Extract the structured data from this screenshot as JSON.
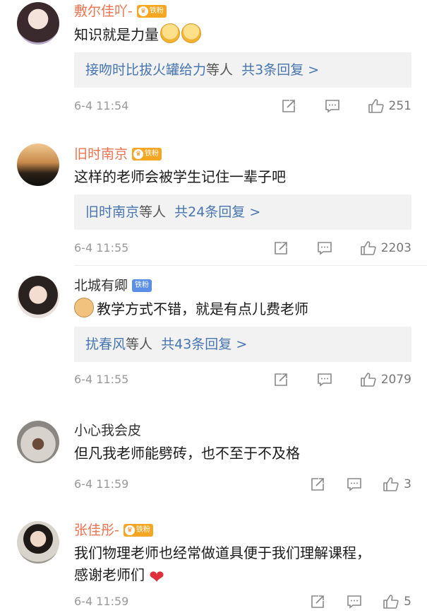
{
  "comments": [
    {
      "username": "敷尔佳吖-",
      "badge": "铁粉",
      "text": "知识就是力量",
      "reply_box": {
        "who": "接吻时比拔火罐给力",
        "mid": "等人",
        "count": "共3条回复 >"
      },
      "time": "6-4 11:54",
      "likes": "251"
    },
    {
      "username": "旧时南京",
      "badge": "铁粉",
      "text": "这样的老师会被学生记住一辈子吧",
      "reply_box": {
        "who": "旧时南京",
        "mid": "等人",
        "count": "共24条回复 >"
      },
      "time": "6-4 11:55",
      "likes": "2203"
    },
    {
      "username": "北城有卿",
      "badge": "铁粉",
      "text": "教学方式不错，就是有点儿费老师",
      "reply_box": {
        "who": "扰春风",
        "mid": "等人",
        "count": "共43条回复 >"
      },
      "time": "6-4 11:55",
      "likes": "2079"
    },
    {
      "username": "小心我会皮",
      "text": "但凡我老师能劈砖，也不至于不及格",
      "time": "6-4 11:59",
      "likes": "3"
    },
    {
      "username": "张佳彤-",
      "badge": "铁粉",
      "text_line1": "我们物理老师也经常做道具便于我们理解课程，",
      "text_line2": "感谢老师们",
      "time": "6-4 11:59",
      "likes": "5"
    }
  ],
  "colors": {
    "username_orange": "#eb7350",
    "link_blue": "#4775b0",
    "reply_bg": "#f2f2f2",
    "meta_gray": "#999999"
  },
  "icons": [
    "share-icon",
    "comment-icon",
    "like-icon",
    "laugh-emoji",
    "doge-emoji",
    "heart-emoji"
  ]
}
